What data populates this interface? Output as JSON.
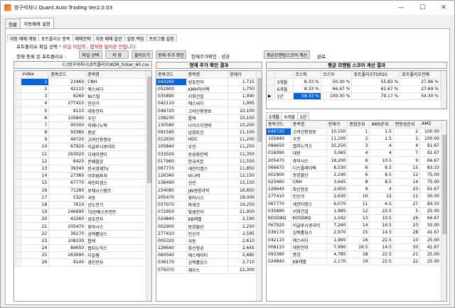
{
  "window": {
    "title": "방구석지니 Quant Auto Trading Ver2.0.03"
  },
  "main_tabs": [
    {
      "label": "현황"
    },
    {
      "label": "자동매매 설정"
    }
  ],
  "sub_tabs": [
    {
      "label": "자동 매매 계좌"
    },
    {
      "label": "포트폴리오 종목"
    },
    {
      "label": "매매전략"
    },
    {
      "label": "자동 매매 옵션"
    },
    {
      "label": "설정 백업"
    },
    {
      "label": "프로그램 설정"
    }
  ],
  "portfolio": {
    "file_label": "포트폴리오 파일 선택",
    "warning": "* 파일 미입력 , 캡쳐용 덮어쓴 안됩니다.",
    "current_label": "현재 등록 된 포트폴리오 :",
    "buttons": {
      "file_select": "파일 선택",
      "save": "저 장",
      "load": "불러오기",
      "check_price": "현재 주가 확인",
      "calc_momentum": "평균모멘텀스코어 계산"
    },
    "price_status": "현재주가확인 : 성공",
    "calc_status": "완료",
    "path": "C:\\방구석지니\\포트폴리오\\KOR_ticker_60.csv"
  },
  "left_table": {
    "headers": [
      "index",
      "종목코드",
      "종목명"
    ],
    "rows": [
      [
        "1",
        "23460",
        "CNH"
      ],
      [
        "2",
        "42110",
        "에스씨디"
      ],
      [
        "3",
        "8260",
        "NI스틸"
      ],
      [
        "4",
        "277410",
        "인산가"
      ],
      [
        "5",
        "8110",
        "대동전자"
      ],
      [
        "6",
        "105840",
        "우진"
      ],
      [
        "7",
        "95500",
        "미래나노텍"
      ],
      [
        "8",
        "93380",
        "풍강"
      ],
      [
        "9",
        "49720",
        "고려신용정보"
      ],
      [
        "10",
        "67920",
        "이글루시큐리티"
      ],
      [
        "11",
        "263020",
        "디케이앤디"
      ],
      [
        "12",
        "8420",
        "문배철강"
      ],
      [
        "13",
        "39340",
        "한국경제TV"
      ],
      [
        "14",
        "27360",
        "아주IB투자"
      ],
      [
        "15",
        "67770",
        "세진티엠스"
      ],
      [
        "16",
        "71280",
        "로체시스템즈"
      ],
      [
        "17",
        "5320",
        "국동"
      ],
      [
        "18",
        "7610",
        "선도전기"
      ],
      [
        "19",
        "246690",
        "TS인베스트먼트"
      ],
      [
        "20",
        "43260",
        "성호전자"
      ],
      [
        "21",
        "205470",
        "휴마시스"
      ],
      [
        "22",
        "36170",
        "심텍홀딩스"
      ],
      [
        "23",
        "108230",
        "톱텍"
      ],
      [
        "24",
        "84650",
        "랩지노믹스"
      ],
      [
        "25",
        "263690",
        "디알젬"
      ],
      [
        "26",
        "9140",
        "경인전자"
      ]
    ]
  },
  "price_title": "현재 주가 확인 결과",
  "price_table": {
    "headers": [
      "종목코드",
      "종목명",
      "현재가"
    ],
    "rows": [
      [
        "043260",
        "성호전자",
        "1,715"
      ],
      [
        "052900",
        "KMH하이텍",
        "1,750"
      ],
      [
        "035890",
        "서희건설",
        "1,990"
      ],
      [
        "042110",
        "에스씨디",
        "1,995"
      ],
      [
        "049720",
        "고려신용정보",
        "10,100"
      ],
      [
        "108230",
        "톱텍",
        "10,150"
      ],
      [
        "130580",
        "나이스디앤비",
        "10,200"
      ],
      [
        "091590",
        "남화토건",
        "11,100"
      ],
      [
        "012630",
        "HDC",
        "11,200"
      ],
      [
        "105840",
        "우진",
        "11,250"
      ],
      [
        "033500",
        "동성화인텍",
        "11,350"
      ],
      [
        "017960",
        "한국카본",
        "11,550"
      ],
      [
        "067770",
        "세진티엠스",
        "11,850"
      ],
      [
        "126340",
        "비나텍",
        "12,150"
      ],
      [
        "136490",
        "선진",
        "15,150"
      ],
      [
        "234080",
        "JW생명과학",
        "16,850"
      ],
      [
        "205470",
        "휴마시스",
        "18,000"
      ],
      [
        "037070",
        "파세코",
        "19,250"
      ],
      [
        "072950",
        "빛샘전자",
        "21,950"
      ],
      [
        "024840",
        "KB레벨",
        "2,190"
      ],
      [
        "002900",
        "동양물산",
        "2,250"
      ],
      [
        "277410",
        "인산가",
        "2,595"
      ],
      [
        "005320",
        "국동",
        "2,610"
      ],
      [
        "126640",
        "화신정공",
        "2,645"
      ],
      [
        "060540",
        "에스에이티",
        "2,685"
      ],
      [
        "036170",
        "심텍홀딩스",
        "2,710"
      ],
      [
        "079370",
        "제우스",
        "22,300"
      ]
    ]
  },
  "momentum_title": "평균 모멘텀 스코어 계산 결과",
  "momentum_summary": {
    "headers": [
      "",
      "",
      "코스피",
      "코스닥",
      "포트폴리오TOP20",
      "포트폴리오전체"
    ],
    "rows": [
      [
        "",
        "3개월",
        "8.33 %",
        "50.00 %",
        "55.83 %",
        "27.96 %"
      ],
      [
        "",
        "6개월",
        "8.33 %",
        "66.67 %",
        "61.67 %",
        "27.69 %"
      ],
      [
        "▶",
        "1년",
        "58.33 %",
        "100.00 %",
        "79.17 %",
        "54.30 %"
      ]
    ]
  },
  "momentum_tabs": [
    {
      "label": "3개월"
    },
    {
      "label": "6개월"
    },
    {
      "label": "1년"
    }
  ],
  "momentum_table": {
    "headers": [
      "종목코드",
      "종목명",
      "현재가",
      "종합순위",
      "AMS순위",
      "변동성순위",
      "AMS"
    ],
    "rows": [
      [
        "049720",
        "고려신용정보",
        "10,150",
        "1",
        "1.5",
        "2",
        "100.00"
      ],
      [
        "105840",
        "우진",
        "11,100",
        "2",
        "1.5",
        "2",
        "100.00"
      ],
      [
        "084650",
        "랩지노믹스",
        "32,250",
        "3",
        "4",
        "4",
        "91.67"
      ],
      [
        "016090",
        "대현",
        "3,065",
        "4",
        "4",
        "7",
        "91.67"
      ],
      [
        "205470",
        "휴마시스",
        "18,200",
        "6",
        "10.5",
        "9",
        "66.67"
      ],
      [
        "066670",
        "디스플레이텍",
        "8,530",
        "6",
        "6.5",
        "15",
        "83.33"
      ],
      [
        "002900",
        "동양물산",
        "2,240",
        "6",
        "8.5",
        "12",
        "75.00"
      ],
      [
        "023460",
        "CNH",
        "3,645",
        "8",
        "8.5",
        "14",
        "75.00"
      ],
      [
        "126640",
        "화신정공",
        "2,650",
        "9",
        "4",
        "23",
        "91.67"
      ],
      [
        "277410",
        "인산가",
        "2,630",
        "10",
        "12",
        "11",
        "50.00"
      ],
      [
        "067770",
        "세진티엠스",
        "6,070",
        "11",
        "6.5",
        "27",
        "83.33"
      ],
      [
        "035890",
        "서희건설",
        "1,985",
        "12",
        "22.5",
        "5",
        "25.00"
      ],
      [
        "KOSDAQ",
        "KOSDAQ",
        "1,042",
        "13",
        "10.5",
        "26",
        "66.67"
      ],
      [
        "067920",
        "이글루시큐리티",
        "7,260",
        "14",
        "16.5",
        "23",
        "50.00"
      ],
      [
        "036170",
        "심텍홀딩스",
        "2,970",
        "15",
        "14.5",
        "28",
        "41.67"
      ],
      [
        "042110",
        "에스씨디",
        "1,995",
        "16",
        "22.5",
        "10",
        "25.00"
      ],
      [
        "008110",
        "대동전자",
        "7,990",
        "16.5",
        "14.5",
        "30",
        "41.67"
      ],
      [
        "093380",
        "풍강",
        "4,785",
        "18",
        "22.5",
        "21",
        "25.00"
      ],
      [
        "024840",
        "KB레벨",
        "2,170",
        "19",
        "22.5",
        "22",
        "25.00"
      ]
    ]
  }
}
